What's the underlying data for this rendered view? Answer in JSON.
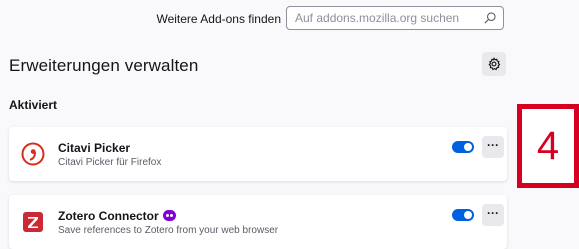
{
  "header": {
    "find_more_label": "Weitere Add-ons finden",
    "search_placeholder": "Auf addons.mozilla.org suchen"
  },
  "page_title": "Erweiterungen verwalten",
  "section_heading": "Aktiviert",
  "extensions": [
    {
      "name": "Citavi Picker",
      "description": "Citavi Picker für Firefox",
      "enabled": true
    },
    {
      "name": "Zotero Connector",
      "description": "Save references to Zotero from your web browser",
      "enabled": true
    }
  ],
  "more_label": "···",
  "annotation_number": "4",
  "colors": {
    "accent": "#0061e0",
    "annotation": "#d70022",
    "private_badge": "#8000d7"
  }
}
